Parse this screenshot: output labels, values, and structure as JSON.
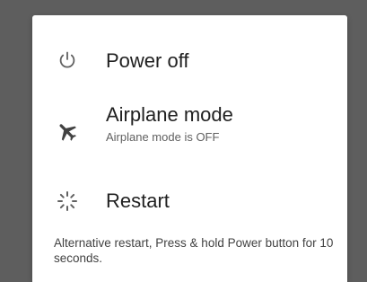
{
  "power_menu": {
    "items": [
      {
        "label": "Power off",
        "icon": "power-icon"
      },
      {
        "label": "Airplane mode",
        "sublabel": "Airplane mode is OFF",
        "icon": "airplane-icon"
      },
      {
        "label": "Restart",
        "icon": "restart-icon"
      }
    ],
    "footnote": "Alternative restart, Press & hold Power button for 10 seconds."
  },
  "colors": {
    "scrim": "#5e5e5e",
    "dialog_background": "#ffffff",
    "primary_text": "#212121",
    "secondary_text": "#616161"
  }
}
